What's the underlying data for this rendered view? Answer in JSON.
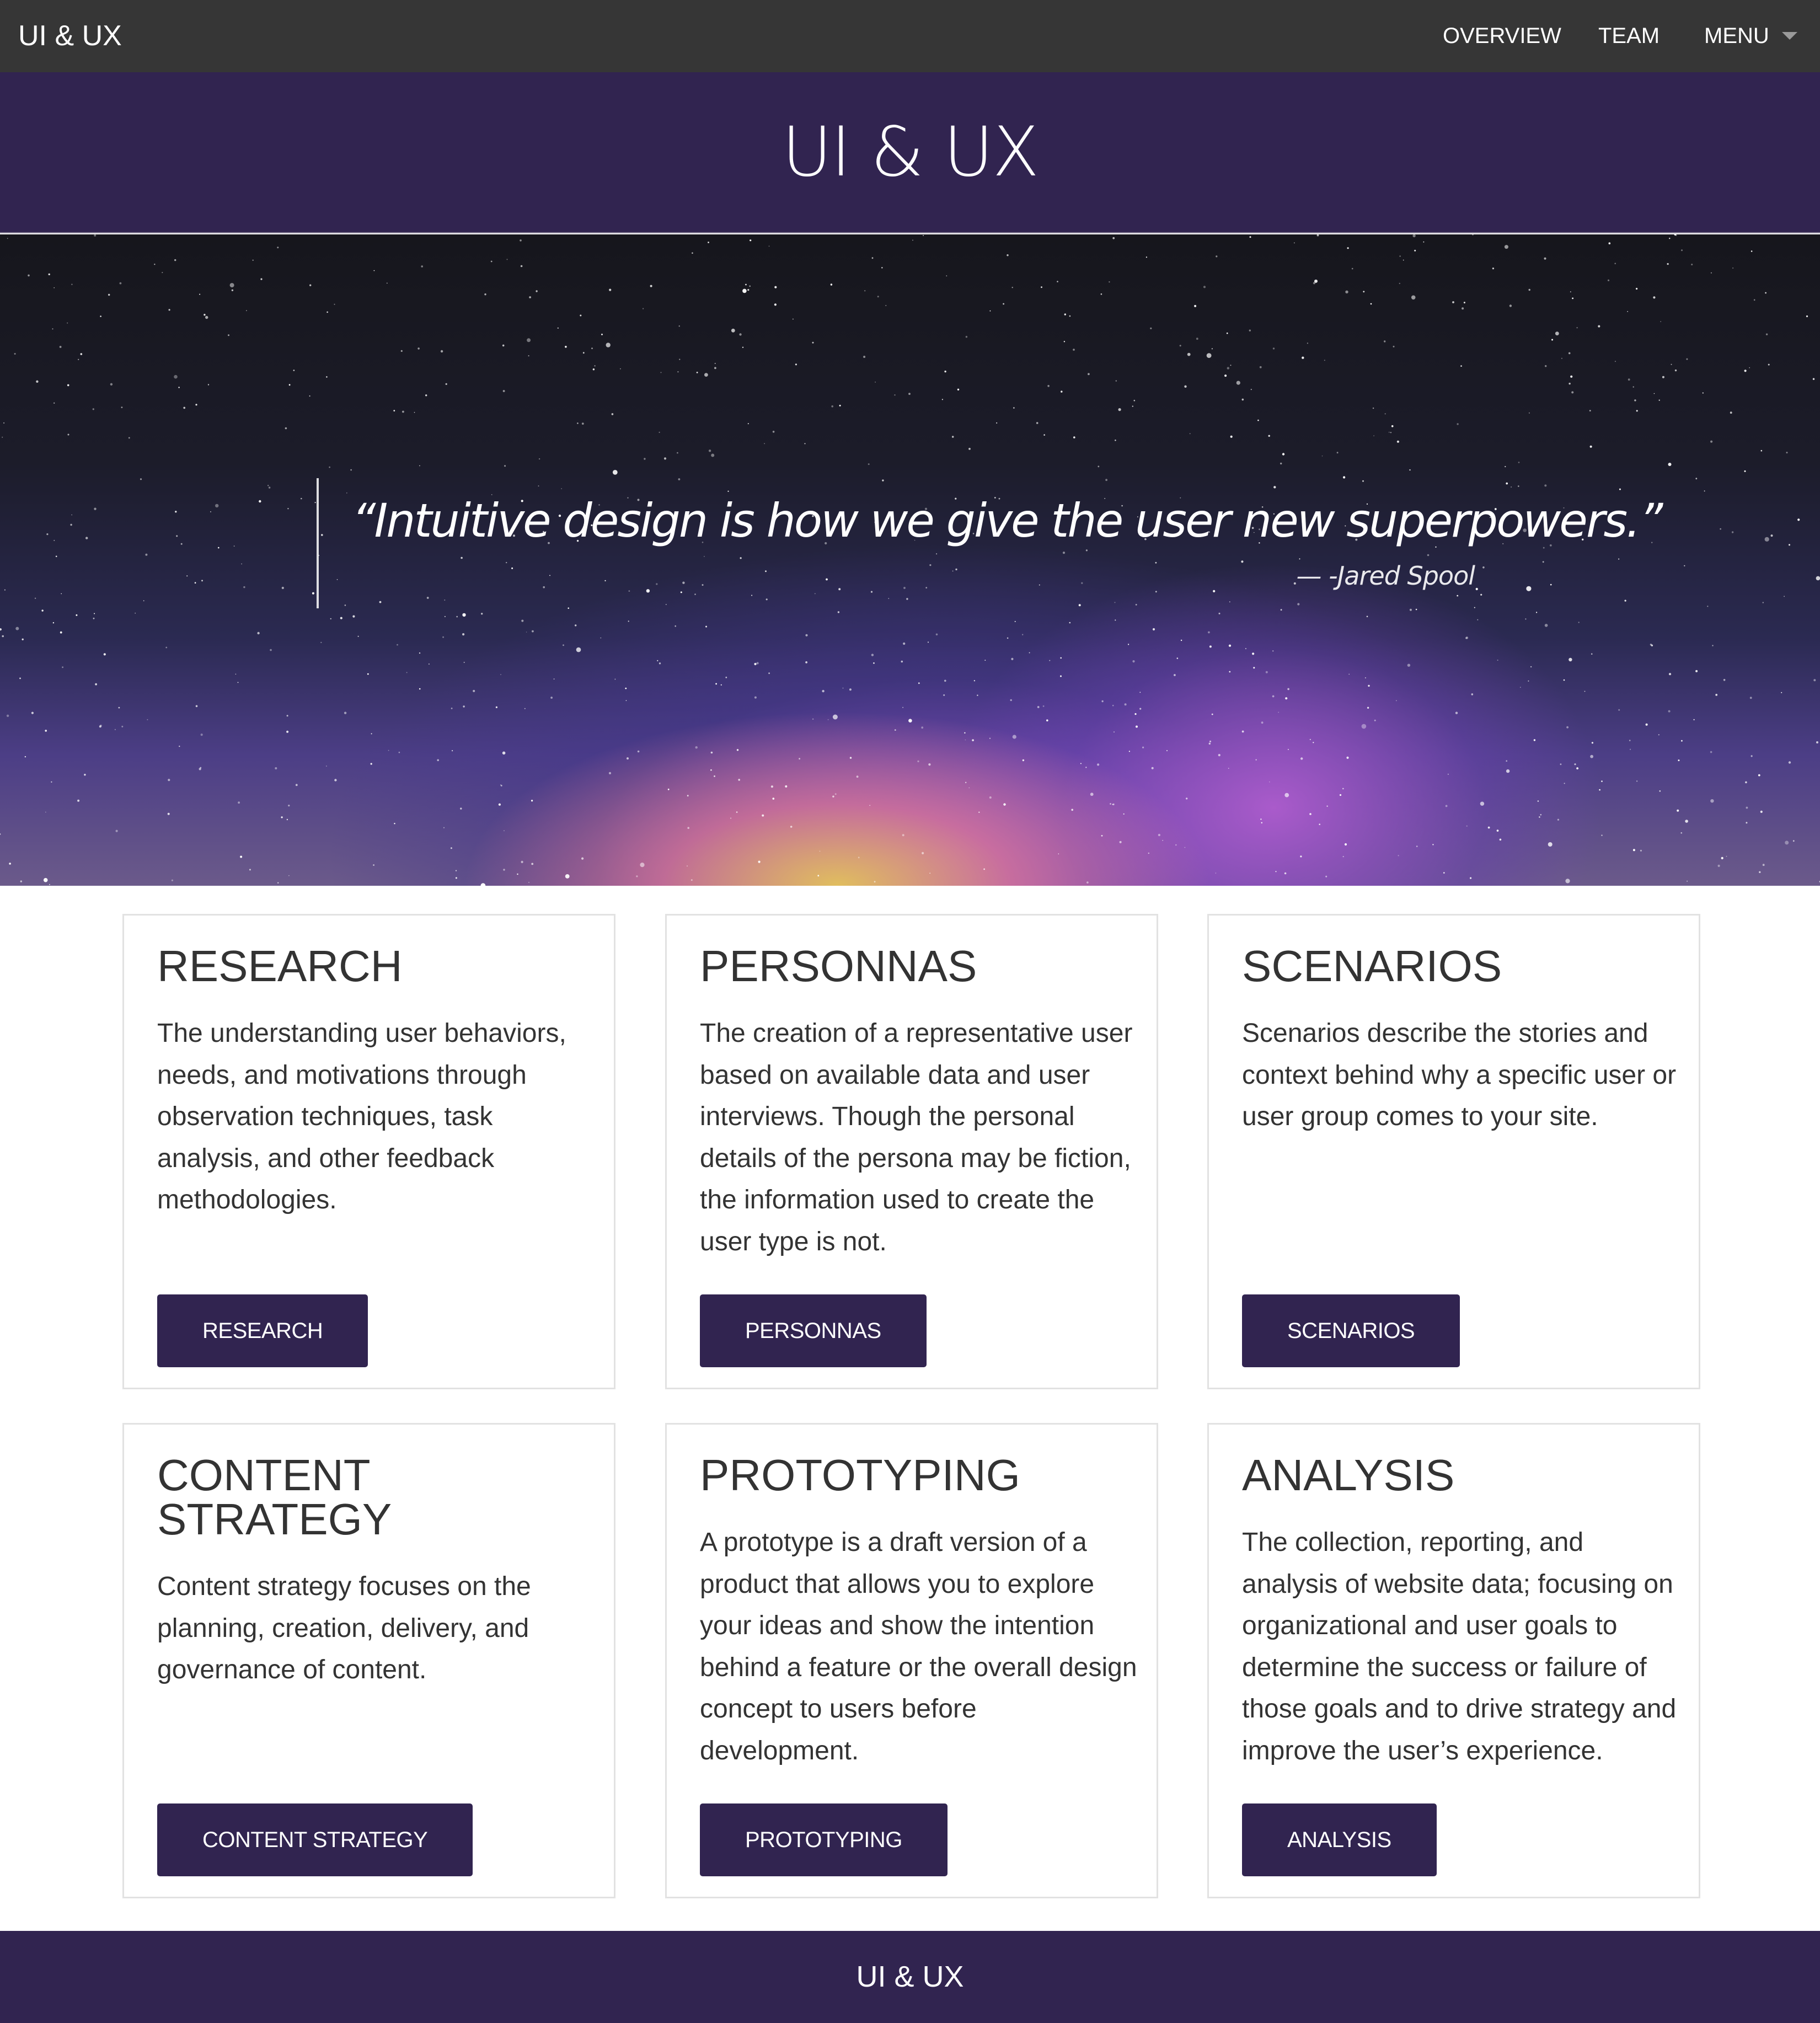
{
  "nav": {
    "brand": "UI & UX",
    "links": [
      "OVERVIEW",
      "TEAM",
      "MENU"
    ],
    "menu_icon": "caret-down-icon"
  },
  "header": {
    "title": "UI & UX"
  },
  "hero": {
    "quote": "“Intuitive design is how we give the user new superpowers.”",
    "cite": "— -Jared Spool"
  },
  "cards": [
    {
      "title": "RESEARCH",
      "description": "The understanding user behaviors, needs, and motivations through observation techniques, task analysis, and other feedback methodologies.",
      "button": "RESEARCH"
    },
    {
      "title": "PERSONNAS",
      "description": "The creation of a representative user based on available data and user interviews. Though the personal details of the persona may be fiction, the information used to create the user type is not.",
      "button": "PERSONNAS"
    },
    {
      "title": "SCENARIOS",
      "description": "Scenarios describe the stories and context behind why a specific user or user group comes to your site.",
      "button": "SCENARIOS"
    },
    {
      "title": "CONTENT STRATEGY",
      "description": "Content strategy focuses on the planning, creation, delivery, and governance of content.",
      "button": "CONTENT STRATEGY"
    },
    {
      "title": "PROTOTYPING",
      "description": "A prototype is a draft version of a product that allows you to explore your ideas and show the intention behind a feature or the overall design concept to users before development.",
      "button": "PROTOTYPING"
    },
    {
      "title": "ANALYSIS",
      "description": "The collection, reporting, and analysis of website data; focusing on organizational and user goals to determine the success or failure of those goals and to drive strategy and improve the user’s experience.",
      "button": "ANALYSIS"
    }
  ],
  "footer": {
    "text": "UI & UX"
  },
  "colors": {
    "nav_bg": "#363636",
    "brand_purple": "#312450",
    "card_border": "#e2e2e2",
    "text": "#333333"
  }
}
